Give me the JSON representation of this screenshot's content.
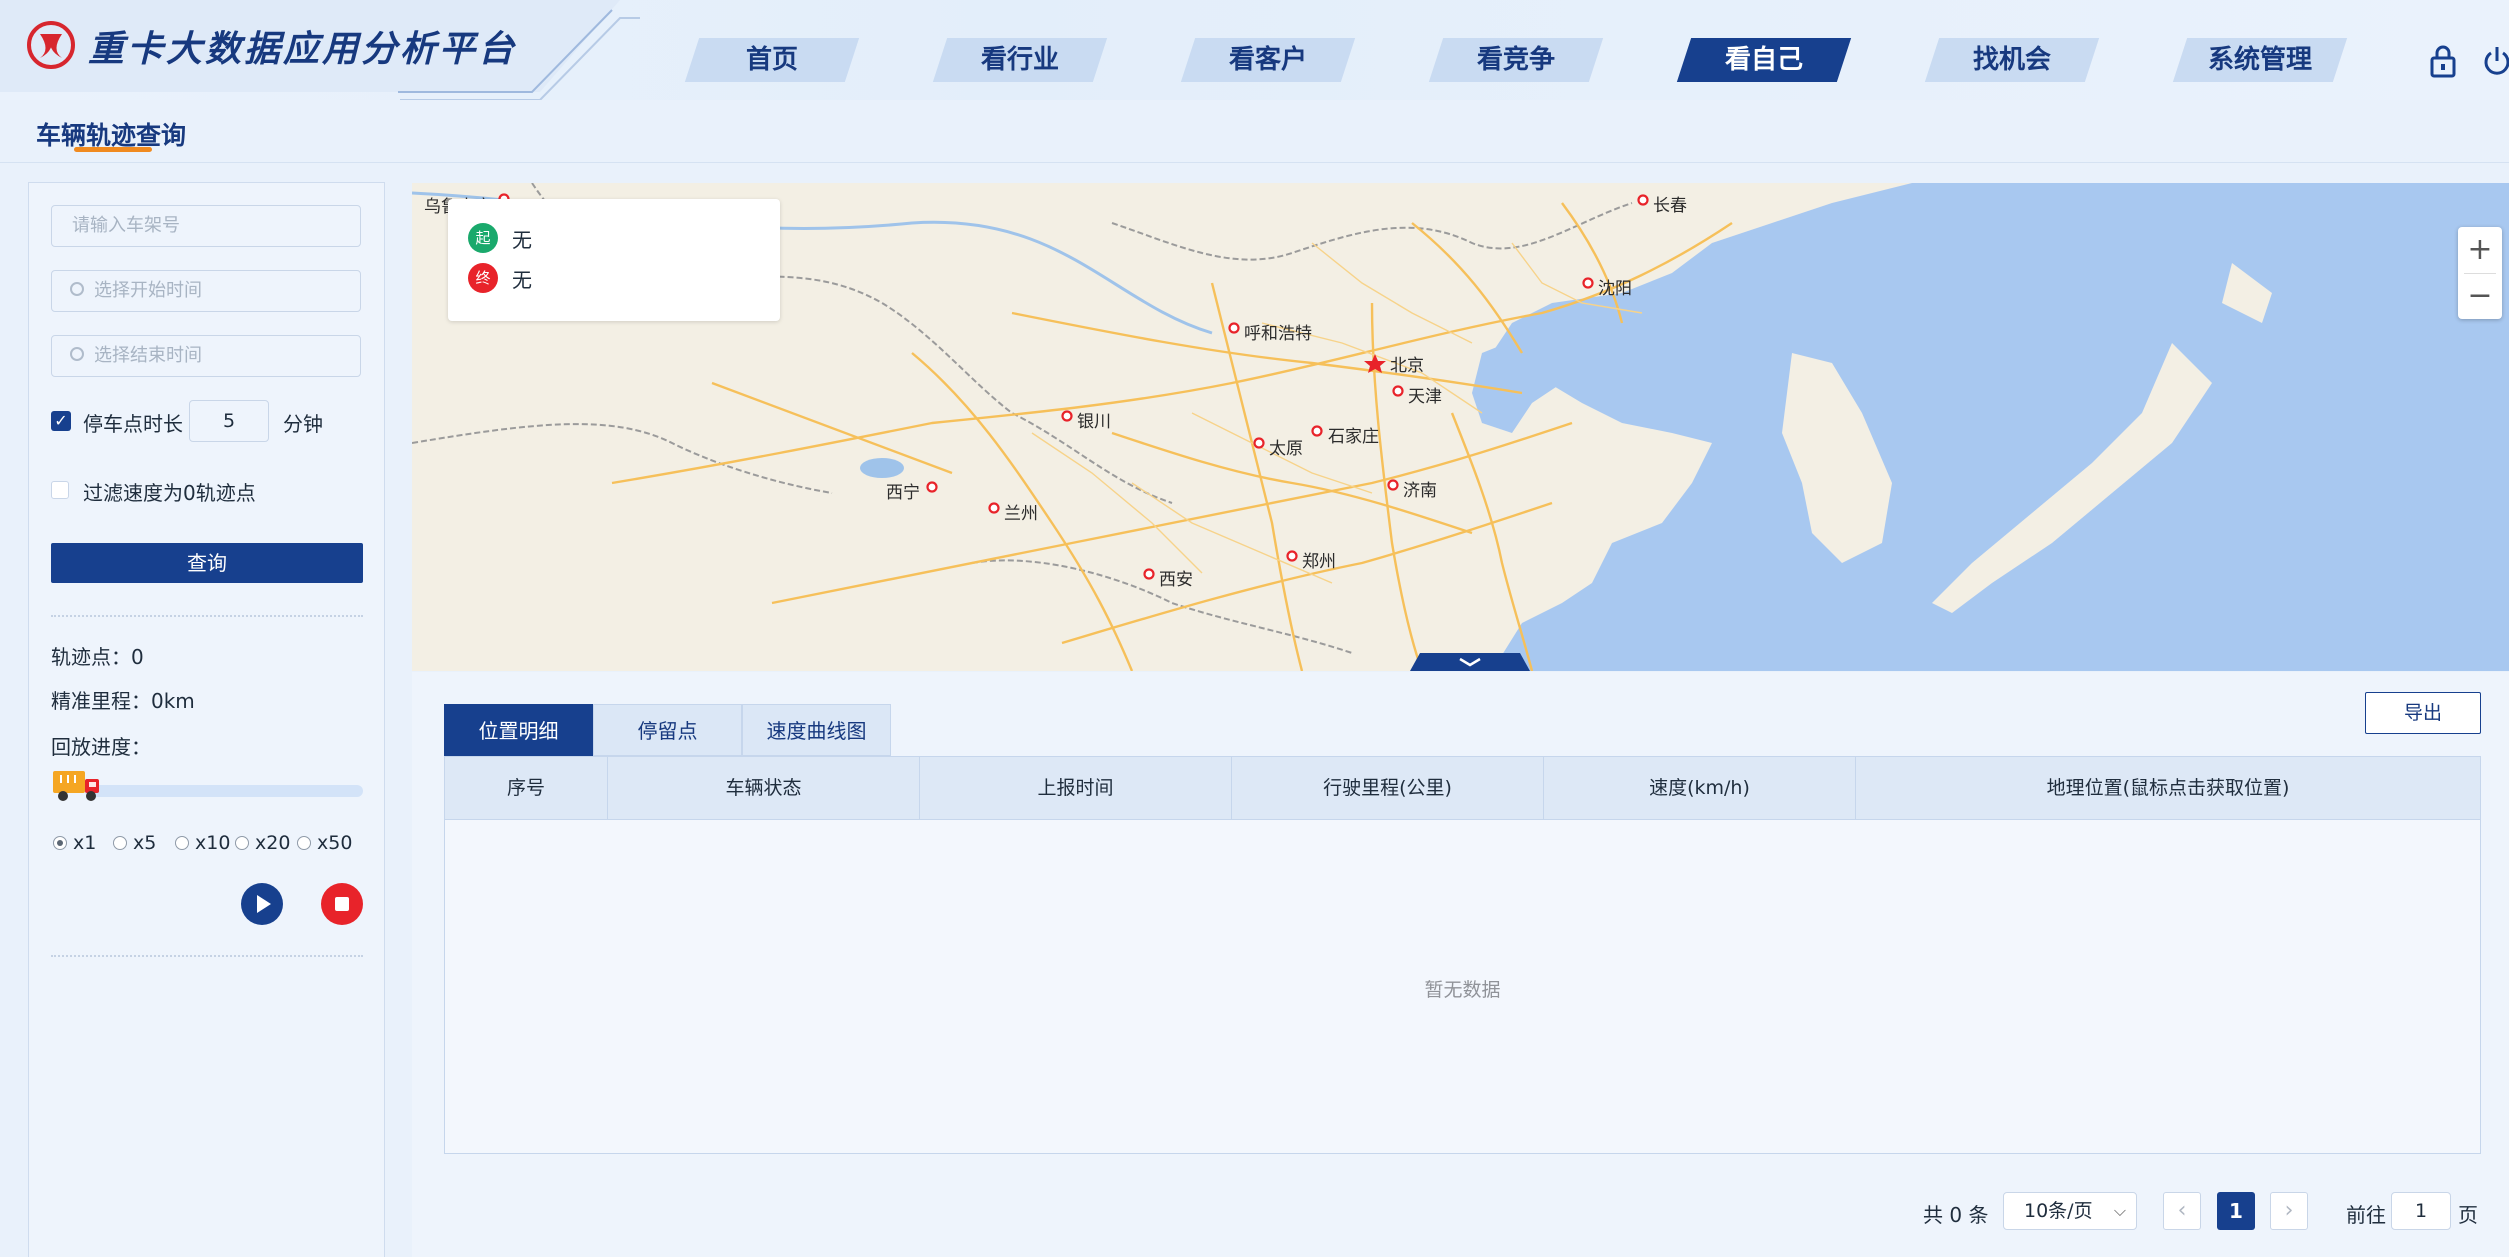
{
  "app": {
    "title": "重卡大数据应用分析平台"
  },
  "nav": {
    "items": [
      {
        "label": "首页"
      },
      {
        "label": "看行业"
      },
      {
        "label": "看客户"
      },
      {
        "label": "看竞争"
      },
      {
        "label": "看自己"
      },
      {
        "label": "找机会"
      },
      {
        "label": "系统管理"
      }
    ],
    "active_index": 4
  },
  "header_icons": [
    "lock-icon",
    "power-icon"
  ],
  "page": {
    "title": "车辆轨迹查询"
  },
  "query_form": {
    "vin_placeholder": "请输入车架号",
    "start_time_placeholder": "选择开始时间",
    "end_time_placeholder": "选择结束时间",
    "stop_duration_label": "停车点时长",
    "stop_duration_checked": true,
    "stop_duration_value": "5",
    "stop_duration_unit": "分钟",
    "filter_zero_speed_label": "过滤速度为0轨迹点",
    "filter_zero_speed_checked": false,
    "query_button": "查询"
  },
  "stats": {
    "track_points": "轨迹点：0",
    "mileage": "精准里程：0km",
    "playback_label": "回放进度："
  },
  "playback": {
    "progress": 0,
    "speeds": [
      "x1",
      "x5",
      "x10",
      "x20",
      "x50"
    ],
    "selected_speed": "x1"
  },
  "map": {
    "legend": {
      "start_badge": "起",
      "start_value": "无",
      "end_badge": "终",
      "end_value": "无"
    },
    "zoom_in": "+",
    "zoom_out": "−",
    "cities": [
      "乌鲁木齐",
      "长春",
      "沈阳",
      "呼和浩特",
      "北京",
      "天津",
      "银川",
      "石家庄",
      "太原",
      "西宁",
      "兰州",
      "济南",
      "郑州",
      "西安"
    ],
    "colors": {
      "sea": "#a8c8f0",
      "land": "#f3efe4",
      "road": "#f6c05a"
    }
  },
  "tabs": [
    {
      "label": "位置明细"
    },
    {
      "label": "停留点"
    },
    {
      "label": "速度曲线图"
    }
  ],
  "export_button": "导出",
  "table": {
    "columns": [
      "序号",
      "车辆状态",
      "上报时间",
      "行驶里程(公里)",
      "速度(km/h)",
      "地理位置(鼠标点击获取位置)"
    ],
    "rows": [],
    "empty_text": "暂无数据"
  },
  "pagination": {
    "total_text": "共 0 条",
    "page_size": "10条/页",
    "current_page": "1",
    "goto_prefix": "前往",
    "goto_value": "1",
    "goto_suffix": "页"
  },
  "colors": {
    "primary": "#17408e",
    "accent": "#f08a1f",
    "danger": "#e8232a",
    "success": "#1aa96c"
  }
}
